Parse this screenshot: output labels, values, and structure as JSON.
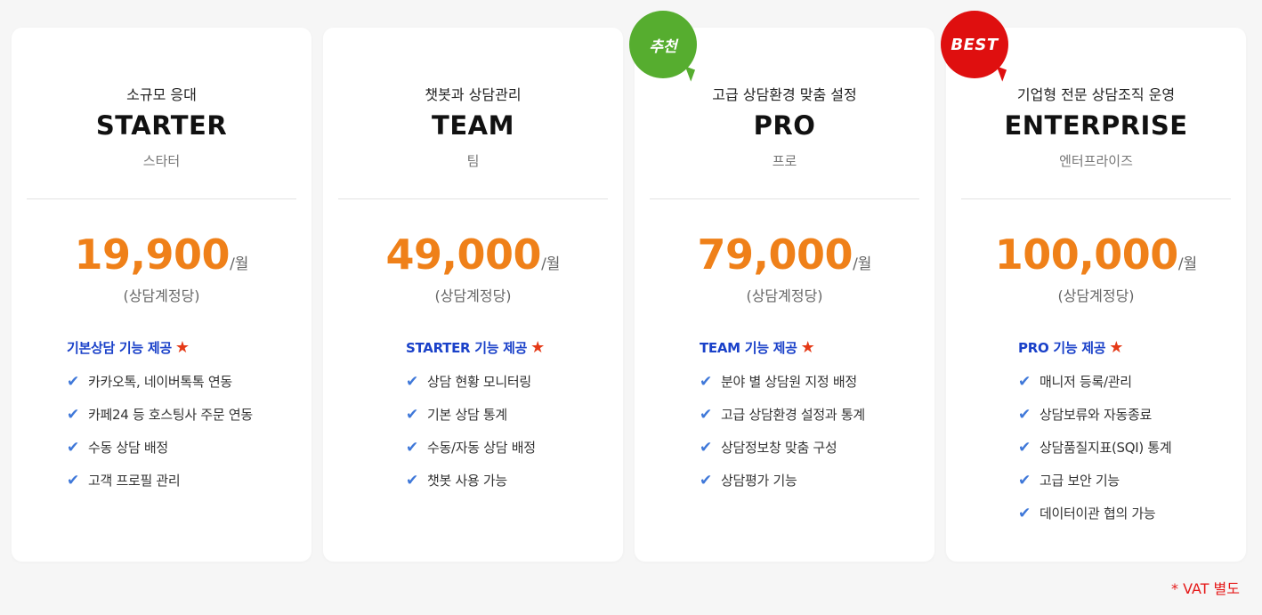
{
  "plans": [
    {
      "subtitle": "소규모 응대",
      "name": "STARTER",
      "name_kr": "스타터",
      "price": "19,900",
      "per": "/월",
      "per_account": "(상담계정당)",
      "features_title": "기본상담 기능 제공",
      "features": [
        "카카오톡, 네이버톡톡 연동",
        "카페24 등 호스팅사 주문 연동",
        "수동 상담 배정",
        "고객 프로필 관리"
      ]
    },
    {
      "subtitle": "챗봇과 상담관리",
      "name": "TEAM",
      "name_kr": "팀",
      "price": "49,000",
      "per": "/월",
      "per_account": "(상담계정당)",
      "features_title": "STARTER 기능 제공",
      "features": [
        "상담 현황 모니터링",
        "기본 상담 통계",
        "수동/자동 상담 배정",
        "챗봇 사용 가능"
      ]
    },
    {
      "subtitle": "고급 상담환경 맞춤 설정",
      "name": "PRO",
      "name_kr": "프로",
      "price": "79,000",
      "per": "/월",
      "per_account": "(상담계정당)",
      "features_title": "TEAM 기능 제공",
      "features": [
        "분야 별 상담원 지정 배정",
        "고급 상담환경 설정과 통계",
        "상담정보창 맞춤 구성",
        "상담평가 기능"
      ],
      "badge": "추천"
    },
    {
      "subtitle": "기업형 전문 상담조직 운영",
      "name": "ENTERPRISE",
      "name_kr": "엔터프라이즈",
      "price": "100,000",
      "per": "/월",
      "per_account": "(상담계정당)",
      "features_title": "PRO 기능 제공",
      "features": [
        "매니저 등록/관리",
        "상담보류와 자동종료",
        "상담품질지표(SQI) 통계",
        "고급 보안 기능",
        "데이터이관 협의 가능"
      ],
      "badge": "BEST"
    }
  ],
  "vat_note": "* VAT 별도",
  "colors": {
    "price": "#ef8019",
    "feature_title": "#1a41c9",
    "check": "#3f78d9",
    "star": "#e53a17",
    "badge_recommend": "#56ad2f",
    "badge_best": "#df0f0f",
    "vat": "#e51a1a"
  },
  "icons": {
    "check": "check-icon",
    "star": "star-icon"
  }
}
